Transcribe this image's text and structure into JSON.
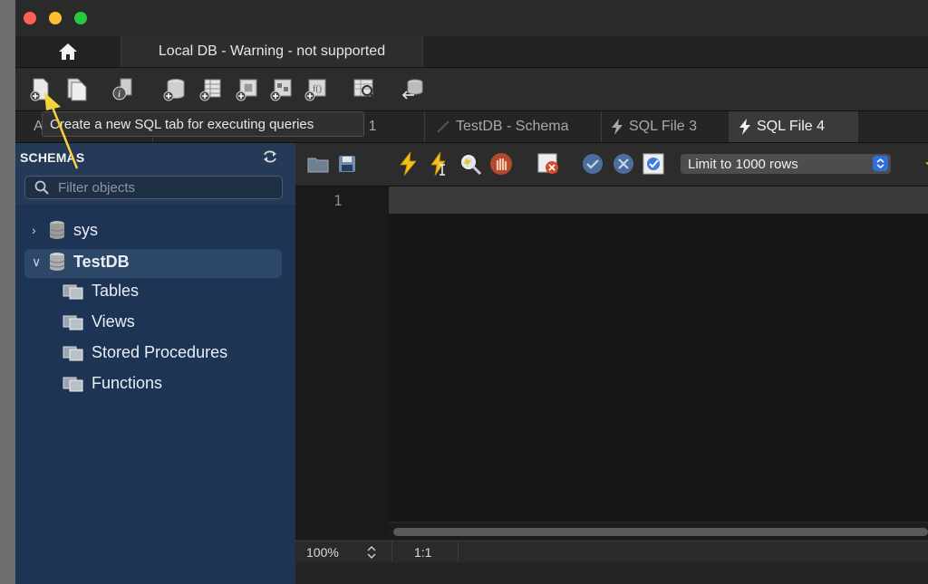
{
  "connection_tab": {
    "title": "Local DB - Warning - not supported"
  },
  "tooltip": {
    "text": "Create a new SQL tab for executing queries"
  },
  "editor_tabs": [
    {
      "label": "A",
      "active": false
    },
    {
      "label": "uery 1",
      "active": false
    },
    {
      "label": "TestDB - Schema",
      "active": false
    },
    {
      "label": "SQL File 3",
      "active": false
    },
    {
      "label": "SQL File 4",
      "active": true
    }
  ],
  "sidebar": {
    "header": "SCHEMAS",
    "filter_placeholder": "Filter objects",
    "schemas": [
      {
        "name": "sys",
        "expanded": false
      },
      {
        "name": "TestDB",
        "expanded": true,
        "children": [
          "Tables",
          "Views",
          "Stored Procedures",
          "Functions"
        ]
      }
    ]
  },
  "editor": {
    "line_numbers": [
      "1"
    ],
    "limit_label": "Limit to 1000 rows"
  },
  "status": {
    "zoom": "100%",
    "cursor": "1:1"
  },
  "colors": {
    "sidebar_bg": "#1e3455",
    "accent_blue": "#2f6fdc",
    "bolt_yellow": "#f1c21b",
    "arrow_yellow": "#f5d33a"
  }
}
